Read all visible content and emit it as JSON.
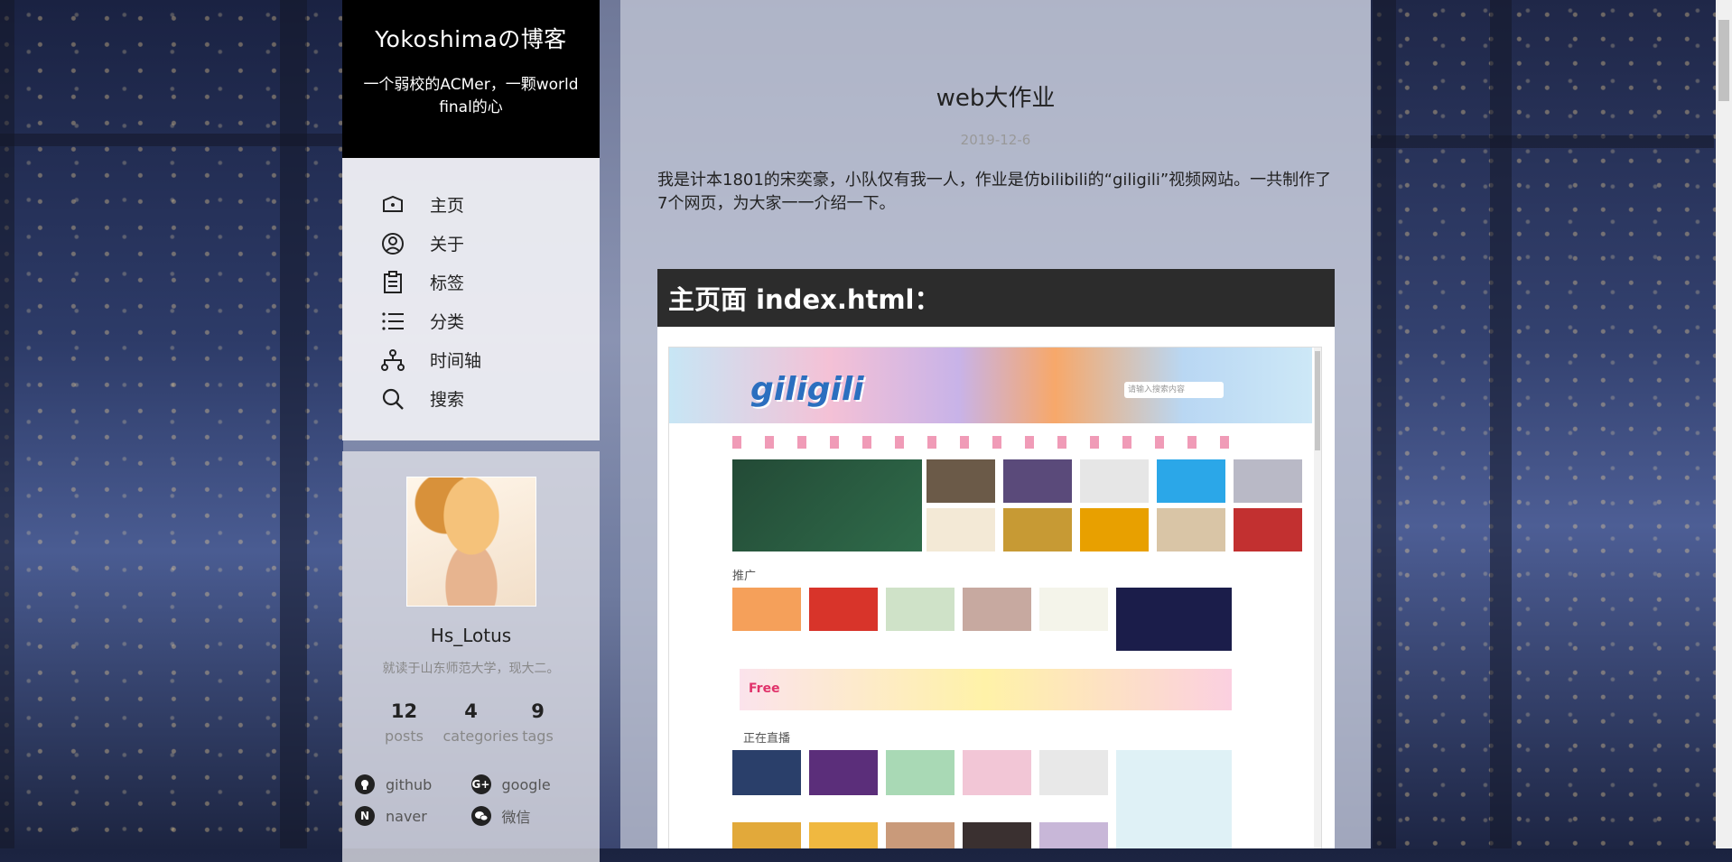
{
  "site": {
    "title": "Yokoshimaの博客",
    "subtitle": "一个弱校的ACMer，一颗world final的心"
  },
  "menu": [
    {
      "label": "主页",
      "icon": "home-icon"
    },
    {
      "label": "关于",
      "icon": "user-icon"
    },
    {
      "label": "标签",
      "icon": "clipboard-icon"
    },
    {
      "label": "分类",
      "icon": "list-icon"
    },
    {
      "label": "时间轴",
      "icon": "sitemap-icon"
    },
    {
      "label": "搜索",
      "icon": "search-icon"
    }
  ],
  "profile": {
    "name": "Hs_Lotus",
    "description": "就读于山东师范大学，现大二。",
    "stats": [
      {
        "value": "12",
        "label": "posts"
      },
      {
        "value": "4",
        "label": "categories"
      },
      {
        "value": "9",
        "label": "tags"
      }
    ],
    "links": [
      {
        "label": "github",
        "icon": "github-icon",
        "glyph": ""
      },
      {
        "label": "google",
        "icon": "google-plus-icon",
        "glyph": "G+"
      },
      {
        "label": "naver",
        "icon": "naver-icon",
        "glyph": "N"
      },
      {
        "label": "微信",
        "icon": "wechat-icon",
        "glyph": ""
      }
    ]
  },
  "post": {
    "title": "web大作业",
    "date": "2019-12-6",
    "body": "我是计本1801的宋奕豪，小队仅有我一人，作业是仿bilibili的“giligili”视频网站。一共制作了7个网页，为大家一一介绍一下。",
    "section_heading": "主页面 index.html：",
    "screenshot": {
      "logo": "giligili",
      "search_placeholder": "请输入搜索内容",
      "promo_label": "推广",
      "live_label": "正在直播",
      "promo_banner": "Free"
    }
  },
  "colors": {
    "brand_bg": "#000000",
    "heading_bg": "#2c2c2c"
  }
}
